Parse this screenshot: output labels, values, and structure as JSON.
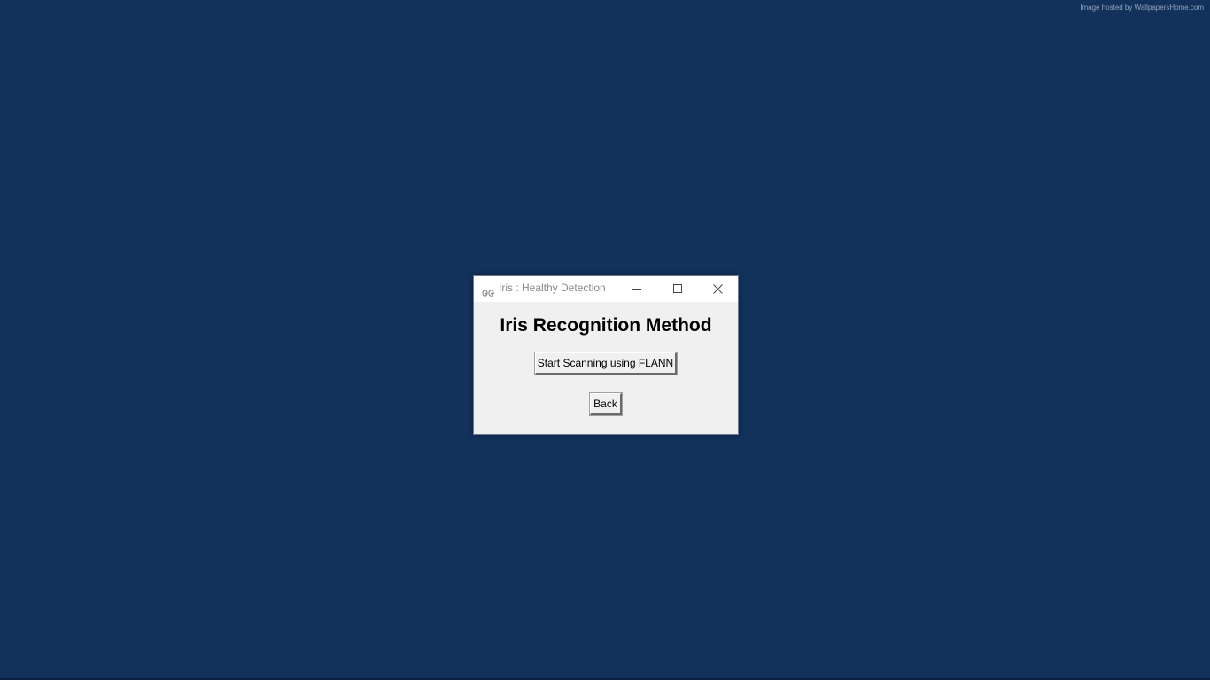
{
  "desktop": {
    "watermark": "Image hosted by WallpapersHome.com"
  },
  "window": {
    "title": "Iris : Healthy Detection",
    "icon": "eyes-icon",
    "controls": {
      "minimize": "minimize-icon",
      "maximize": "maximize-icon",
      "close": "close-icon"
    },
    "heading": "Iris Recognition Method",
    "buttons": {
      "scan_label": "Start Scanning using FLANN",
      "back_label": "Back"
    }
  },
  "colors": {
    "desktop_background": "#12315b",
    "window_background": "#f0f0f0",
    "titlebar_background": "#ffffff"
  }
}
